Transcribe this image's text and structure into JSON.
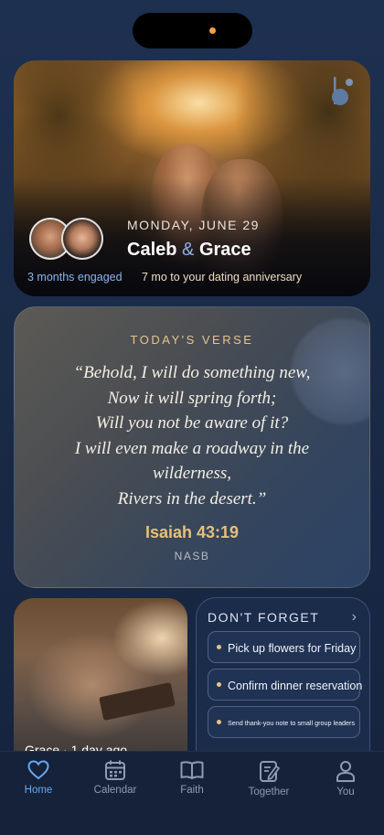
{
  "hero": {
    "date": "MONDAY, JUNE 29",
    "name_one": "Caleb",
    "ampersand": "&",
    "name_two": "Grace",
    "engaged": "3 months engaged",
    "anniversary": "7 mo to your dating anniversary"
  },
  "verse": {
    "heading": "TODAY'S VERSE",
    "lines": [
      "“Behold, I will do something new,",
      "Now it will spring forth;",
      "Will you not be aware of it?",
      "I will even make a roadway in the",
      "wilderness,",
      "Rivers in the desert.”"
    ],
    "reference": "Isaiah 43:19",
    "translation": "NASB"
  },
  "photo": {
    "caption": "Grace · 1 day ago"
  },
  "reminders": {
    "title": "DON'T FORGET",
    "chevron": "›",
    "items": [
      "Pick up flowers for Friday",
      "Confirm dinner reservation",
      "Send thank-you note to small group leaders"
    ]
  },
  "tabs": [
    {
      "label": "Home",
      "icon": "heart-icon",
      "active": true
    },
    {
      "label": "Calendar",
      "icon": "calendar-icon",
      "active": false
    },
    {
      "label": "Faith",
      "icon": "book-icon",
      "active": false
    },
    {
      "label": "Together",
      "icon": "notebook-icon",
      "active": false
    },
    {
      "label": "You",
      "icon": "person-icon",
      "active": false
    }
  ],
  "colors": {
    "accent": "#68a8ec",
    "gold": "#e6c07a",
    "background": "#1a2b48"
  }
}
